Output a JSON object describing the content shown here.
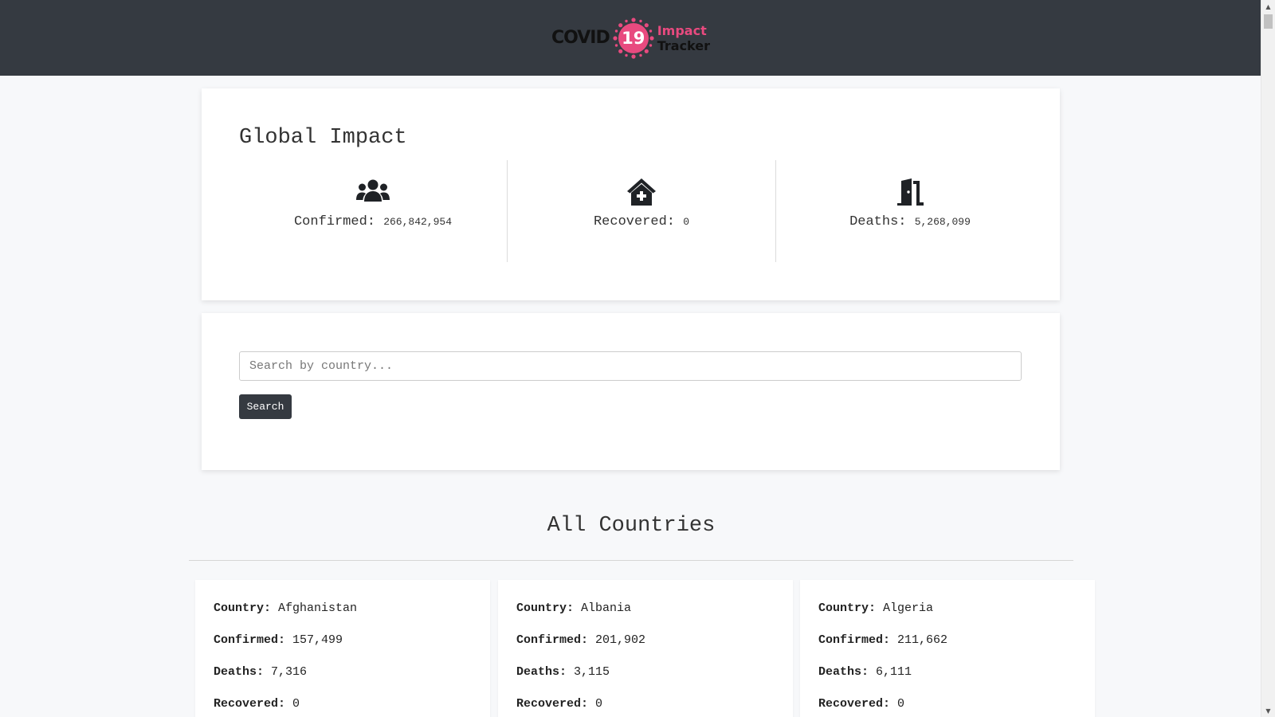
{
  "header": {
    "logo_covid": "COVID",
    "logo_number": "19",
    "logo_impact": "Impact",
    "logo_tracker": "Tracker",
    "brand_color": "#e84a7f",
    "bg_color": "#353a41"
  },
  "global": {
    "title": "Global Impact",
    "stats": [
      {
        "icon": "users-icon",
        "label": "Confirmed:",
        "value": "266,842,954"
      },
      {
        "icon": "house-medical-icon",
        "label": "Recovered:",
        "value": "0"
      },
      {
        "icon": "door-open-icon",
        "label": "Deaths:",
        "value": "5,268,099"
      }
    ]
  },
  "search": {
    "placeholder": "Search by country...",
    "button_label": "Search"
  },
  "countries_section": {
    "title": "All Countries",
    "cards": [
      {
        "country_label": "Country:",
        "country": "Afghanistan",
        "confirmed_label": "Confirmed:",
        "confirmed": "157,499",
        "deaths_label": "Deaths:",
        "deaths": "7,316",
        "recovered_label": "Recovered:",
        "recovered": "0"
      },
      {
        "country_label": "Country:",
        "country": "Albania",
        "confirmed_label": "Confirmed:",
        "confirmed": "201,902",
        "deaths_label": "Deaths:",
        "deaths": "3,115",
        "recovered_label": "Recovered:",
        "recovered": "0"
      },
      {
        "country_label": "Country:",
        "country": "Algeria",
        "confirmed_label": "Confirmed:",
        "confirmed": "211,662",
        "deaths_label": "Deaths:",
        "deaths": "6,111",
        "recovered_label": "Recovered:",
        "recovered": "0"
      }
    ]
  }
}
